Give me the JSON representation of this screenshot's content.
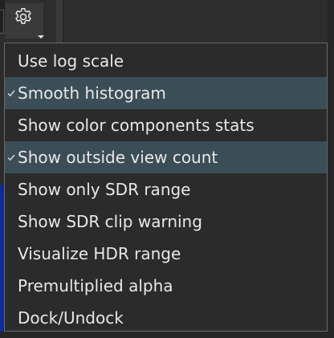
{
  "toolbar": {
    "settings_icon": "gear-icon",
    "dropdown_icon": "caret-down-icon"
  },
  "menu": {
    "items": [
      {
        "label": "Use log scale",
        "checked": false
      },
      {
        "label": "Smooth histogram",
        "checked": true
      },
      {
        "label": "Show color components stats",
        "checked": false
      },
      {
        "label": "Show outside view count",
        "checked": true
      },
      {
        "label": "Show only SDR range",
        "checked": false
      },
      {
        "label": "Show SDR clip warning",
        "checked": false
      },
      {
        "label": "Visualize HDR range",
        "checked": false
      },
      {
        "label": "Premultiplied alpha",
        "checked": false
      },
      {
        "label": "Dock/Undock",
        "checked": false
      }
    ]
  },
  "colors": {
    "menu_bg": "#2b2b2b",
    "checked_bg": "#3b4d56",
    "text": "#e8e8e8",
    "border": "#6a6a6a",
    "accent_blue": "#0c2a9a"
  }
}
